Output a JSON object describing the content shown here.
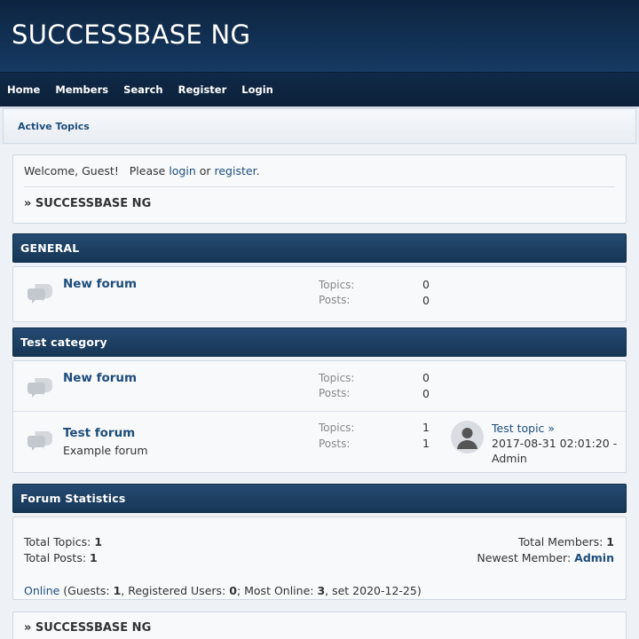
{
  "header": {
    "title": "SUCCESSBASE NG"
  },
  "nav": {
    "home": "Home",
    "members": "Members",
    "search": "Search",
    "register": "Register",
    "login": "Login"
  },
  "subbar": {
    "active_topics": "Active Topics"
  },
  "welcome": {
    "prefix": "Welcome, Guest!   Please ",
    "login": "login",
    "or": " or ",
    "register": "register",
    "suffix": ".",
    "breadcrumb": "» SUCCESSBASE NG"
  },
  "categories": [
    {
      "name": "GENERAL",
      "forums": [
        {
          "name": "New forum",
          "desc": "",
          "topics_label": "Topics:",
          "topics": "0",
          "posts_label": "Posts:",
          "posts": "0"
        }
      ]
    },
    {
      "name": "Test category",
      "forums": [
        {
          "name": "New forum",
          "desc": "",
          "topics_label": "Topics:",
          "topics": "0",
          "posts_label": "Posts:",
          "posts": "0"
        },
        {
          "name": "Test forum",
          "desc": "Example forum",
          "topics_label": "Topics:",
          "topics": "1",
          "posts_label": "Posts:",
          "posts": "1",
          "last_post": {
            "title": "Test topic",
            "arrow": "»",
            "date": "2017-08-31 02:01:20 -",
            "author": "Admin"
          }
        }
      ]
    }
  ],
  "stats": {
    "title": "Forum Statistics",
    "total_topics_label": "Total Topics: ",
    "total_topics": "1",
    "total_posts_label": "Total Posts: ",
    "total_posts": "1",
    "total_members_label": "Total Members: ",
    "total_members": "1",
    "newest_member_label": "Newest Member: ",
    "newest_member": "Admin",
    "online_link": "Online",
    "online_guests_label": " (Guests: ",
    "online_guests": "1",
    "online_registered_label": ", Registered Users: ",
    "online_registered": "0",
    "online_most_label": "; Most Online: ",
    "online_most": "3",
    "online_set": ", set 2020-12-25)"
  },
  "footer_crumb": "» SUCCESSBASE NG",
  "colors": {
    "header_bg": "#0d2440",
    "category_bar": "#1f4469",
    "link": "#1d4d7b"
  }
}
